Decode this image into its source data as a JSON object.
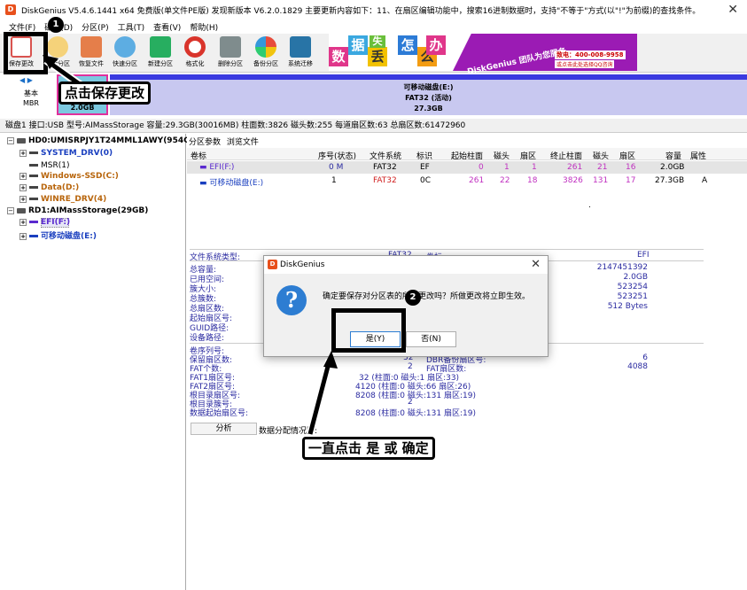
{
  "window": {
    "title": "DiskGenius V5.4.6.1441 x64 免费版(单文件PE版)   发现新版本 V6.2.0.1829   主要更新内容如下：11、在扇区编辑功能中，搜索16进制数据时，支持\"不等于\"方式(以\"!\"为前缀)的查找条件。",
    "close_glyph": "✕"
  },
  "menu": [
    "文件(F)",
    "磁盘(D)",
    "分区(P)",
    "工具(T)",
    "查看(V)",
    "帮助(H)"
  ],
  "toolbar": {
    "buttons": [
      {
        "label": "保存更改",
        "icon": "save-icon",
        "color": "#d9534f"
      },
      {
        "label": "搜索分区",
        "icon": "search-icon",
        "color": "#e0a030"
      },
      {
        "label": "恢复文件",
        "icon": "recover-file-icon",
        "color": "#c0392b"
      },
      {
        "label": "快速分区",
        "icon": "quick-partition-icon",
        "color": "#2e86c1"
      },
      {
        "label": "新建分区",
        "icon": "new-partition-icon",
        "color": "#27ae60"
      },
      {
        "label": "格式化",
        "icon": "format-icon",
        "color": "#c0392b"
      },
      {
        "label": "删除分区",
        "icon": "delete-partition-icon",
        "color": "#7d8c8d"
      },
      {
        "label": "备份分区",
        "icon": "backup-partition-icon",
        "color": "#8e44ad"
      },
      {
        "label": "系统迁移",
        "icon": "system-migrate-icon",
        "color": "#1f6fb2"
      }
    ]
  },
  "ad": {
    "chars": [
      "数",
      "据",
      "丢",
      "失",
      "怎",
      "么",
      "办"
    ],
    "brand": "DiskGenius 团队为您服务",
    "tel": "致电：400-008-9958",
    "qq": "或点击此处选择QQ咨询"
  },
  "disk_nav": {
    "arrows": "◀ ▶",
    "type_line1": "基本",
    "type_line2": "MBR"
  },
  "disk_map": {
    "efi_size": "2.0GB",
    "main_name": "可移动磁盘(E:)",
    "main_fs": "FAT32 (活动)",
    "main_size": "27.3GB"
  },
  "disk_info": "磁盘1 接口:USB  型号:AIMassStorage  容量:29.3GB(30016MB)  柱面数:3826  磁头数:255  每道扇区数:63  总扇区数:61472960",
  "tree": {
    "hd0": "HD0:UMISRPJY1T24MML1AWY(954GB)",
    "hd0_parts": [
      "SYSTEM_DRV(0)",
      "MSR(1)",
      "Windows-SSD(C:)",
      "Data(D:)",
      "WINRE_DRV(4)"
    ],
    "rd1": "RD1:AIMassStorage(29GB)",
    "rd1_parts": [
      "EFI(F:)",
      "可移动磁盘(E:)"
    ]
  },
  "tabs": [
    "分区参数",
    "浏览文件"
  ],
  "partition_table": {
    "columns": [
      "卷标",
      "序号(状态)",
      "文件系统",
      "标识",
      "起始柱面",
      "磁头",
      "扇区",
      "终止柱面",
      "磁头",
      "扇区",
      "容量",
      "属性"
    ],
    "rows": [
      [
        "EFI(F:)",
        "0 M",
        "FAT32",
        "EF",
        "0",
        "1",
        "1",
        "261",
        "21",
        "16",
        "2.0GB",
        ""
      ],
      [
        "可移动磁盘(E:)",
        "1",
        "FAT32",
        "0C",
        "261",
        "22",
        "18",
        "3826",
        "131",
        "17",
        "27.3GB",
        "A"
      ]
    ],
    "dot": "."
  },
  "details": {
    "fs_type_label": "文件系统类型:",
    "fs_type": "FAT32",
    "volume_label_label": "卷标:",
    "volume_label": "EFI",
    "left_labels": [
      "总容量:",
      "已用空间:",
      "簇大小:",
      "总簇数:",
      "总扇区数:",
      "起始扇区号:",
      "GUID路径:",
      "设备路径:"
    ],
    "right_values": [
      "2147451392",
      "2.0GB",
      "523254",
      "523251",
      "512 Bytes"
    ],
    "lower_left": [
      "卷序列号:",
      "保留扇区数:",
      "FAT个数:",
      "FAT1扇区号:",
      "FAT2扇区号:",
      "根目录扇区号:",
      "根目录簇号:",
      "数据起始扇区号:"
    ],
    "lower_mid": [
      "",
      "32",
      "2",
      "32 (柱面:0 磁头:1 扇区:33)",
      "4120 (柱面:0 磁头:66 扇区:26)",
      "8208 (柱面:0 磁头:131 扇区:19)",
      "2",
      "8208 (柱面:0 磁头:131 扇区:19)"
    ],
    "lower_right_labels": [
      "DBR备份扇区号:",
      "FAT扇区数:"
    ],
    "lower_right_values": [
      "6",
      "4088"
    ]
  },
  "analyze": {
    "button": "分析",
    "label": "数据分配情况图:"
  },
  "dialog": {
    "title": "DiskGenius",
    "close": "✕",
    "question": "?",
    "message": "确定要保存对分区表的所有更改吗？所做更改将立即生效。",
    "yes": "是(Y)",
    "no": "否(N)"
  },
  "annotations": {
    "badge1": "1",
    "badge2": "2",
    "callout1": "点击保存更改",
    "callout2": "一直点击 是 或 确定"
  }
}
